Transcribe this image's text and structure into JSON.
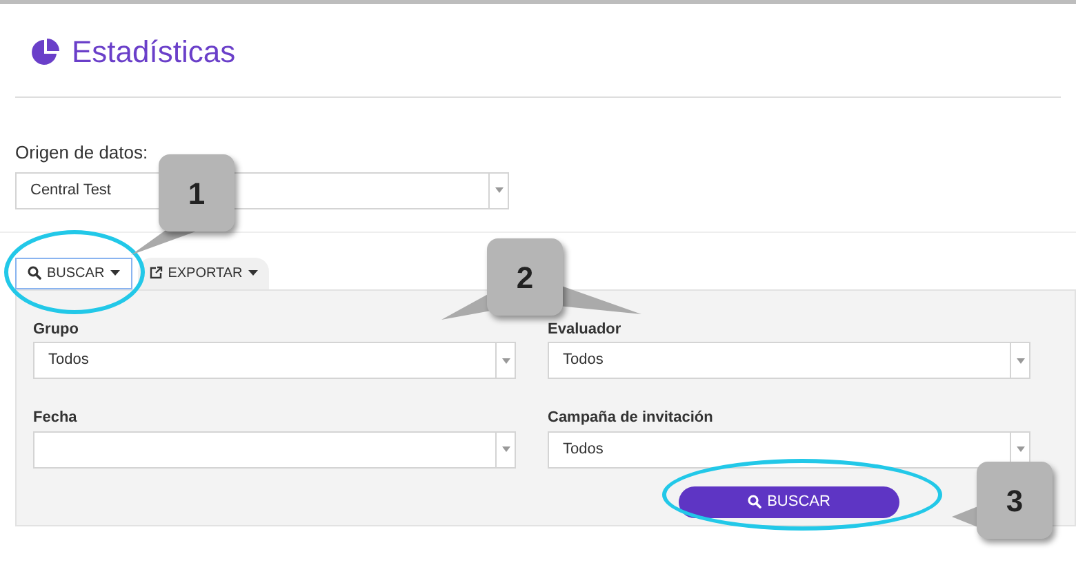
{
  "header": {
    "title": "Estadísticas"
  },
  "data_source": {
    "label": "Origen de datos:",
    "value": "Central Test"
  },
  "tabs": [
    {
      "label": "BUSCAR",
      "kind": "search",
      "selected": true
    },
    {
      "label": "EXPORTAR",
      "kind": "export",
      "selected": false
    }
  ],
  "filters": [
    {
      "label": "Grupo",
      "value": "Todos"
    },
    {
      "label": "Evaluador",
      "value": "Todos"
    },
    {
      "label": "Fecha"
    },
    {
      "label": "Campaña de invitación",
      "value": "Todos"
    }
  ],
  "search_button": {
    "label": "BUSCAR"
  },
  "callouts": [
    {
      "number": "1"
    },
    {
      "number": "2"
    },
    {
      "number": "3"
    }
  ]
}
